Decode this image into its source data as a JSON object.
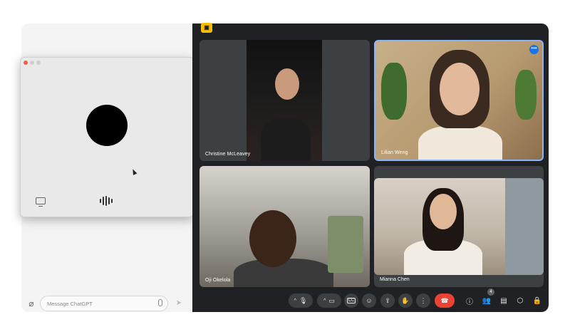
{
  "chatgpt": {
    "composer": {
      "placeholder": "Message ChatGPT",
      "attach_icon": "paperclip-icon",
      "mic_icon": "microphone-icon",
      "send_icon": "send-icon"
    },
    "voice_window": {
      "traffic_lights": [
        "close",
        "minimize",
        "zoom"
      ],
      "orb_color": "#000000",
      "screen_share_icon": "screen-icon",
      "voice_icon": "voice-waveform-icon"
    }
  },
  "meet": {
    "badge_icon": "meet-badge-icon",
    "participants": [
      {
        "name": "Christine McLeavey"
      },
      {
        "name": "Lilian Weng"
      },
      {
        "name": "Oji Okelola"
      },
      {
        "name": "Mianna Chen"
      }
    ],
    "participant_count": "4",
    "accent": "#8ab4f8",
    "end_call_color": "#ea4335",
    "controls": [
      "mic-toggle",
      "camera-toggle",
      "captions",
      "emoji",
      "present",
      "raise-hand",
      "more-options",
      "end-call"
    ],
    "side_controls": [
      "info",
      "people",
      "chat",
      "activities",
      "host-controls"
    ]
  },
  "colors": {
    "meet_bg": "#202124",
    "tile_bg": "#3c4043",
    "voice_window_bg": "#e9e9e9"
  }
}
